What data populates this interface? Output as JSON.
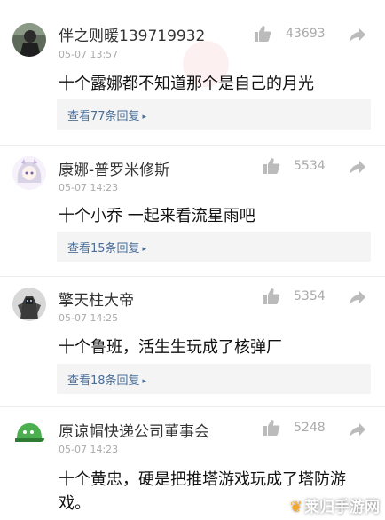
{
  "colors": {
    "link": "#4a6e98",
    "muted": "#aaaaaa",
    "reply_bg": "#f4f4f4",
    "divider": "#ececec"
  },
  "comments": [
    {
      "username": "伴之则暖139719932",
      "time": "05-07 13:57",
      "likes": "43693",
      "content": "十个露娜都不知道那个是自己的月光",
      "replies": "查看77条回复",
      "avatar_icon": "dark-figure-avatar"
    },
    {
      "username": "康娜-普罗米修斯",
      "time": "05-07 14:23",
      "likes": "5534",
      "content": "十个小乔  一起来看流星雨吧",
      "replies": "查看15条回复",
      "avatar_icon": "anime-girl-avatar"
    },
    {
      "username": "擎天柱大帝",
      "time": "05-07 14:25",
      "likes": "5354",
      "content": "十个鲁班，活生生玩成了核弹厂",
      "replies": "查看18条回复",
      "avatar_icon": "robot-avatar"
    },
    {
      "username": "原谅帽快递公司董事会",
      "time": "05-07 14:23",
      "likes": "5248",
      "content": "十个黄忠，硬是把推塔游戏玩成了塔防游戏。",
      "avatar_icon": "green-hat-avatar"
    }
  ],
  "watermark": {
    "text": "莱归手游网",
    "logo_icon": "leaf-logo-icon"
  }
}
